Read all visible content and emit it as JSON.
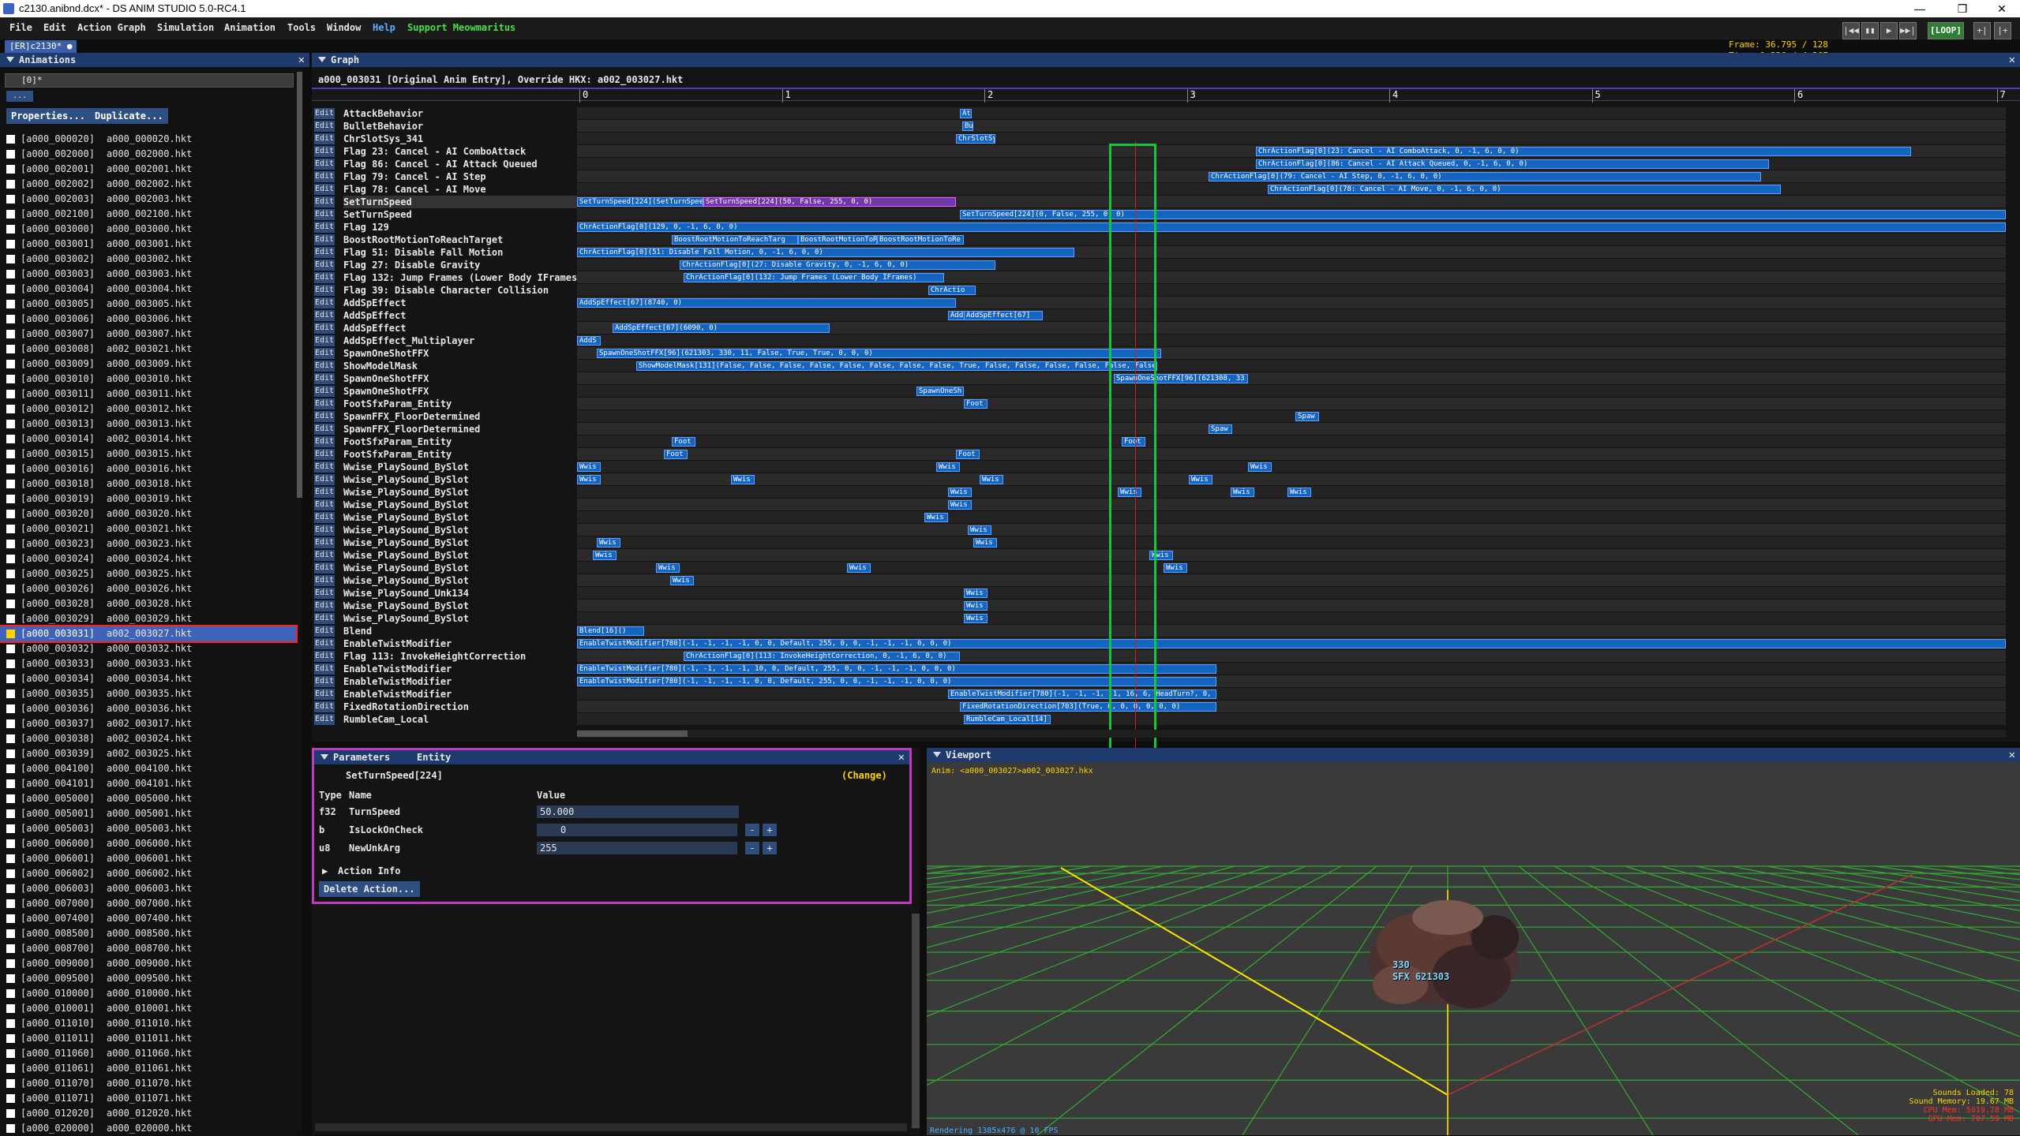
{
  "window": {
    "title": "c2130.anibnd.dcx* - DS ANIM STUDIO 5.0-RC4.1",
    "minimize": "—",
    "maximize": "❒",
    "close": "✕"
  },
  "menu": [
    {
      "label": "File"
    },
    {
      "label": "Edit"
    },
    {
      "label": "Action Graph"
    },
    {
      "label": "Simulation"
    },
    {
      "label": "Animation"
    },
    {
      "label": "Tools"
    },
    {
      "label": "Window"
    },
    {
      "label": "Help"
    },
    {
      "label": "Support Meowmaritus"
    }
  ],
  "colors": {
    "help": "#5ab0ff",
    "support": "#49e049",
    "accent": "#1565c0",
    "selection": "#17c53a",
    "event_selected": "#c03ac0"
  },
  "toolbar": {
    "frame_label": "Frame:",
    "frame_value": "36.795 / 128",
    "time_label": "Time:",
    "time_value": "1.226 / 4.267",
    "loop": "[LOOP]",
    "btns": [
      "|◀◀",
      "▮▮",
      "▶",
      "▶▶|"
    ],
    "extra": [
      "+|",
      "|+"
    ]
  },
  "doc_tab": "[ER]c2130* ●",
  "animations": {
    "title": "Animations",
    "filter": "[0]*",
    "clear_btn": "...",
    "properties": "Properties...",
    "duplicate": "Duplicate...",
    "items": [
      [
        "[a000_000020]",
        "a000_000020.hkt"
      ],
      [
        "[a000_002000]",
        "a000_002000.hkt"
      ],
      [
        "[a000_002001]",
        "a000_002001.hkt"
      ],
      [
        "[a000_002002]",
        "a000_002002.hkt"
      ],
      [
        "[a000_002003]",
        "a000_002003.hkt"
      ],
      [
        "[a000_002100]",
        "a000_002100.hkt"
      ],
      [
        "[a000_003000]",
        "a000_003000.hkt"
      ],
      [
        "[a000_003001]",
        "a000_003001.hkt"
      ],
      [
        "[a000_003002]",
        "a000_003002.hkt"
      ],
      [
        "[a000_003003]",
        "a000_003003.hkt"
      ],
      [
        "[a000_003004]",
        "a000_003004.hkt"
      ],
      [
        "[a000_003005]",
        "a000_003005.hkt"
      ],
      [
        "[a000_003006]",
        "a000_003006.hkt"
      ],
      [
        "[a000_003007]",
        "a000_003007.hkt"
      ],
      [
        "[a000_003008]",
        "a002_003021.hkt"
      ],
      [
        "[a000_003009]",
        "a000_003009.hkt"
      ],
      [
        "[a000_003010]",
        "a000_003010.hkt"
      ],
      [
        "[a000_003011]",
        "a000_003011.hkt"
      ],
      [
        "[a000_003012]",
        "a000_003012.hkt"
      ],
      [
        "[a000_003013]",
        "a000_003013.hkt"
      ],
      [
        "[a000_003014]",
        "a002_003014.hkt"
      ],
      [
        "[a000_003015]",
        "a000_003015.hkt"
      ],
      [
        "[a000_003016]",
        "a000_003016.hkt"
      ],
      [
        "[a000_003018]",
        "a000_003018.hkt"
      ],
      [
        "[a000_003019]",
        "a000_003019.hkt"
      ],
      [
        "[a000_003020]",
        "a000_003020.hkt"
      ],
      [
        "[a000_003021]",
        "a000_003021.hkt"
      ],
      [
        "[a000_003023]",
        "a000_003023.hkt"
      ],
      [
        "[a000_003024]",
        "a000_003024.hkt"
      ],
      [
        "[a000_003025]",
        "a000_003025.hkt"
      ],
      [
        "[a000_003026]",
        "a000_003026.hkt"
      ],
      [
        "[a000_003028]",
        "a000_003028.hkt"
      ],
      [
        "[a000_003029]",
        "a000_003029.hkt"
      ],
      [
        "[a000_003031]",
        "a002_003027.hkt"
      ],
      [
        "[a000_003032]",
        "a000_003032.hkt"
      ],
      [
        "[a000_003033]",
        "a000_003033.hkt"
      ],
      [
        "[a000_003034]",
        "a000_003034.hkt"
      ],
      [
        "[a000_003035]",
        "a000_003035.hkt"
      ],
      [
        "[a000_003036]",
        "a000_003036.hkt"
      ],
      [
        "[a000_003037]",
        "a002_003017.hkt"
      ],
      [
        "[a000_003038]",
        "a002_003024.hkt"
      ],
      [
        "[a000_003039]",
        "a002_003025.hkt"
      ],
      [
        "[a000_004100]",
        "a000_004100.hkt"
      ],
      [
        "[a000_004101]",
        "a000_004101.hkt"
      ],
      [
        "[a000_005000]",
        "a000_005000.hkt"
      ],
      [
        "[a000_005001]",
        "a000_005001.hkt"
      ],
      [
        "[a000_005003]",
        "a000_005003.hkt"
      ],
      [
        "[a000_006000]",
        "a000_006000.hkt"
      ],
      [
        "[a000_006001]",
        "a000_006001.hkt"
      ],
      [
        "[a000_006002]",
        "a000_006002.hkt"
      ],
      [
        "[a000_006003]",
        "a000_006003.hkt"
      ],
      [
        "[a000_007000]",
        "a000_007000.hkt"
      ],
      [
        "[a000_007400]",
        "a000_007400.hkt"
      ],
      [
        "[a000_008500]",
        "a000_008500.hkt"
      ],
      [
        "[a000_008700]",
        "a000_008700.hkt"
      ],
      [
        "[a000_009000]",
        "a000_009000.hkt"
      ],
      [
        "[a000_009500]",
        "a000_009500.hkt"
      ],
      [
        "[a000_010000]",
        "a000_010000.hkt"
      ],
      [
        "[a000_010001]",
        "a000_010001.hkt"
      ],
      [
        "[a000_011010]",
        "a000_011010.hkt"
      ],
      [
        "[a000_011011]",
        "a000_011011.hkt"
      ],
      [
        "[a000_011060]",
        "a000_011060.hkt"
      ],
      [
        "[a000_011061]",
        "a000_011061.hkt"
      ],
      [
        "[a000_011070]",
        "a000_011070.hkt"
      ],
      [
        "[a000_011071]",
        "a000_011071.hkt"
      ],
      [
        "[a000_012020]",
        "a000_012020.hkt"
      ],
      [
        "[a000_020000]",
        "a000_020000.hkt"
      ]
    ],
    "selected_index": 33
  },
  "graph": {
    "title": "Graph",
    "header": "a000_003031 [Original Anim Entry], Override HKX: a002_003027.hkt",
    "edit_label": "Edit",
    "ticks": [
      "0",
      "1",
      "2",
      "3",
      "4",
      "5",
      "6",
      "7"
    ],
    "rows": [
      {
        "name": "AttackBehavior",
        "ev": [
          [
            485,
            15,
            "At"
          ]
        ]
      },
      {
        "name": "BulletBehavior",
        "ev": [
          [
            488,
            14,
            "Bu"
          ]
        ]
      },
      {
        "name": "ChrSlotSys_341",
        "ev": [
          [
            480,
            50,
            "ChrSlotSy"
          ]
        ]
      },
      {
        "name": "Flag 23: Cancel - AI ComboAttack",
        "ev": [
          [
            860,
            830,
            "ChrActionFlag[0](23: Cancel - AI ComboAttack, 0, -1, 6, 0, 0)"
          ]
        ]
      },
      {
        "name": "Flag 86: Cancel - AI Attack Queued",
        "ev": [
          [
            860,
            650,
            "ChrActionFlag[0](86: Cancel - AI Attack Queued, 0, -1, 6, 0, 0)"
          ]
        ]
      },
      {
        "name": "Flag 79: Cancel - AI Step",
        "ev": [
          [
            800,
            700,
            "ChrActionFlag[0](79: Cancel - AI Step, 0, -1, 6, 0, 0)"
          ]
        ]
      },
      {
        "name": "Flag 78: Cancel - AI Move",
        "ev": [
          [
            875,
            650,
            "ChrActionFlag[0](78: Cancel - AI Move, 0, -1, 6, 0, 0)"
          ]
        ]
      },
      {
        "name": "SetTurnSpeed",
        "hl": true,
        "ev": [
          [
            0,
            160,
            "SetTurnSpeed[224](SetTurnSpeed"
          ],
          [
            160,
            320,
            "SetTurnSpeed[224](50, False, 255, 0, 0)",
            "sel"
          ]
        ]
      },
      {
        "name": "SetTurnSpeed",
        "ev": [
          [
            485,
            1325,
            "SetTurnSpeed[224](0, False, 255, 0, 0)"
          ]
        ]
      },
      {
        "name": "Flag 129",
        "ev": [
          [
            0,
            1810,
            "ChrActionFlag[0](129, 0, -1, 6, 0, 0)"
          ]
        ]
      },
      {
        "name": "BoostRootMotionToReachTarget",
        "ev": [
          [
            120,
            160,
            "BoostRootMotionToReachTarg"
          ],
          [
            280,
            100,
            "BoostRootMotionToRe"
          ],
          [
            380,
            110,
            "BoostRootMotionToRe"
          ]
        ]
      },
      {
        "name": "Flag 51: Disable Fall Motion",
        "ev": [
          [
            0,
            630,
            "ChrActionFlag[0](51: Disable Fall Motion, 0, -1, 6, 0, 0)"
          ]
        ]
      },
      {
        "name": "Flag 27: Disable Gravity",
        "ev": [
          [
            130,
            400,
            "ChrActionFlag[0](27: Disable Gravity, 0, -1, 6, 0, 0)"
          ]
        ]
      },
      {
        "name": "Flag 132: Jump Frames (Lower Body IFrames)",
        "ev": [
          [
            135,
            330,
            "ChrActionFlag[0](132: Jump Frames (Lower Body IFrames)"
          ]
        ]
      },
      {
        "name": "Flag 39: Disable Character Collision",
        "ev": [
          [
            445,
            60,
            "ChrActio"
          ]
        ]
      },
      {
        "name": "AddSpEffect",
        "ev": [
          [
            0,
            480,
            "AddSpEffect[67](8740, 0)"
          ]
        ]
      },
      {
        "name": "AddSpEffect",
        "ev": [
          [
            470,
            115,
            "AddSpEffect[67](1"
          ],
          [
            490,
            100,
            "AddSpEffect[67]"
          ]
        ]
      },
      {
        "name": "AddSpEffect",
        "ev": [
          [
            45,
            275,
            "AddSpEffect[67](6090, 0)"
          ]
        ]
      },
      {
        "name": "AddSpEffect_Multiplayer",
        "ev": [
          [
            0,
            30,
            "AddS"
          ]
        ]
      },
      {
        "name": "SpawnOneShotFFX",
        "ev": [
          [
            25,
            715,
            "SpawnOneShotFFX[96](621303, 330, 11, False, True, True, 0, 0, 0)"
          ]
        ]
      },
      {
        "name": "ShowModelMask",
        "ev": [
          [
            75,
            660,
            "ShowModelMask[131](False, False, False, False, False, False, False, False, True, False, False, False, False, False, False, False, False)"
          ]
        ]
      },
      {
        "name": "SpawnOneShotFFX",
        "ev": [
          [
            680,
            170,
            "SpawnOneShotFFX[96](621308, 33"
          ]
        ]
      },
      {
        "name": "SpawnOneShotFFX",
        "ev": [
          [
            430,
            60,
            "SpawnOneSh"
          ]
        ]
      },
      {
        "name": "FootSfxParam_Entity",
        "ev": [
          [
            490,
            30,
            "Foot"
          ]
        ]
      },
      {
        "name": "SpawnFFX_FloorDetermined",
        "ev": [
          [
            910,
            30,
            "Spaw"
          ]
        ]
      },
      {
        "name": "SpawnFFX_FloorDetermined",
        "ev": [
          [
            800,
            30,
            "Spaw"
          ]
        ]
      },
      {
        "name": "FootSfxParam_Entity",
        "ev": [
          [
            120,
            30,
            "Foot"
          ],
          [
            690,
            30,
            "Foot"
          ]
        ]
      },
      {
        "name": "FootSfxParam_Entity",
        "ev": [
          [
            110,
            30,
            "Foot"
          ],
          [
            480,
            30,
            "Foot"
          ]
        ]
      },
      {
        "name": "Wwise_PlaySound_BySlot",
        "ev": [
          [
            0,
            30,
            "Wwis"
          ],
          [
            455,
            30,
            "Wwis"
          ],
          [
            850,
            30,
            "Wwis"
          ]
        ]
      },
      {
        "name": "Wwise_PlaySound_BySlot",
        "ev": [
          [
            0,
            30,
            "Wwis"
          ],
          [
            195,
            30,
            "Wwis"
          ],
          [
            510,
            30,
            "Wwis"
          ],
          [
            775,
            30,
            "Wwis"
          ]
        ]
      },
      {
        "name": "Wwise_PlaySound_BySlot",
        "ev": [
          [
            470,
            30,
            "Wwis"
          ],
          [
            685,
            30,
            "Wwis"
          ],
          [
            828,
            30,
            "Wwis"
          ],
          [
            900,
            30,
            "Wwis"
          ]
        ]
      },
      {
        "name": "Wwise_PlaySound_BySlot",
        "ev": [
          [
            470,
            30,
            "Wwis"
          ]
        ]
      },
      {
        "name": "Wwise_PlaySound_BySlot",
        "ev": [
          [
            440,
            30,
            "Wwis"
          ]
        ]
      },
      {
        "name": "Wwise_PlaySound_BySlot",
        "ev": [
          [
            495,
            30,
            "Wwis"
          ]
        ]
      },
      {
        "name": "Wwise_PlaySound_BySlot",
        "ev": [
          [
            25,
            30,
            "Wwis"
          ],
          [
            502,
            30,
            "Wwis"
          ]
        ]
      },
      {
        "name": "Wwise_PlaySound_BySlot",
        "ev": [
          [
            20,
            30,
            "Wwis"
          ],
          [
            725,
            30,
            "Wwis"
          ]
        ]
      },
      {
        "name": "Wwise_PlaySound_BySlot",
        "ev": [
          [
            100,
            30,
            "Wwis"
          ],
          [
            342,
            30,
            "Wwis"
          ],
          [
            743,
            30,
            "Wwis"
          ]
        ]
      },
      {
        "name": "Wwise_PlaySound_BySlot",
        "ev": [
          [
            118,
            30,
            "Wwis"
          ]
        ]
      },
      {
        "name": "Wwise_PlaySound_Unk134",
        "ev": [
          [
            490,
            30,
            "Wwis"
          ]
        ]
      },
      {
        "name": "Wwise_PlaySound_BySlot",
        "ev": [
          [
            490,
            30,
            "Wwis"
          ]
        ]
      },
      {
        "name": "Wwise_PlaySound_BySlot",
        "ev": [
          [
            490,
            30,
            "Wwis"
          ]
        ]
      },
      {
        "name": "Blend",
        "ev": [
          [
            0,
            85,
            "Blend[16]()"
          ]
        ]
      },
      {
        "name": "EnableTwistModifier",
        "ev": [
          [
            0,
            1810,
            "EnableTwistModifier[780](-1, -1, -1, -1, 0, 0, Default, 255, 0, 0, -1, -1, -1, 0, 0, 0)"
          ]
        ]
      },
      {
        "name": "Flag 113: InvokeHeightCorrection",
        "ev": [
          [
            135,
            350,
            "ChrActionFlag[0](113: InvokeHeightCorrection, 0, -1, 6, 0, 0)"
          ]
        ]
      },
      {
        "name": "EnableTwistModifier",
        "ev": [
          [
            0,
            810,
            "EnableTwistModifier[780](-1, -1, -1, -1, 10, 0, Default, 255, 0, 0, -1, -1, -1, 0, 0, 0)"
          ]
        ]
      },
      {
        "name": "EnableTwistModifier",
        "ev": [
          [
            0,
            810,
            "EnableTwistModifier[780](-1, -1, -1, -1, 0, 0, Default, 255, 0, 0, -1, -1, -1, 0, 0, 0)"
          ]
        ]
      },
      {
        "name": "EnableTwistModifier",
        "ev": [
          [
            470,
            340,
            "EnableTwistModifier[780](-1, -1, -1, -1, 16, 6, HeadTurn?, 0,"
          ]
        ]
      },
      {
        "name": "FixedRotationDirection",
        "ev": [
          [
            485,
            325,
            "FixedRotationDirection[703](True, 0, 0, 0, 0, 0, 0)"
          ]
        ]
      },
      {
        "name": "RumbleCam_Local",
        "ev": [
          [
            490,
            110,
            "RumbleCam_Local[14]"
          ]
        ]
      }
    ]
  },
  "params": {
    "tab1": "Parameters",
    "tab2": "Entity",
    "action": "SetTurnSpeed[224]",
    "change": "(Change)",
    "col_type": "Type",
    "col_name": "Name",
    "col_value": "Value",
    "rows": [
      {
        "type": "f32",
        "name": "TurnSpeed",
        "value": "50.000"
      },
      {
        "type": "b",
        "name": "IsLockOnCheck",
        "value": "0"
      },
      {
        "type": "u8",
        "name": "NewUnkArg",
        "value": "255"
      }
    ],
    "minus": "-",
    "plus": "+",
    "action_info": "Action Info",
    "delete": "Delete Action..."
  },
  "viewport": {
    "title": "Viewport",
    "anim": "Anim: <a000_003027>a002_003027.hkx",
    "sfx_id": "330",
    "sfx_label": "SFX 621303",
    "stats": [
      "Sounds Loaded: 78",
      "Sound Memory: 19.67 MB",
      "CPU Mem: 5019.78 MB",
      "GPU Mem: 707.59 MB"
    ],
    "render": "Rendering 1385x476 @ 10 FPS"
  }
}
